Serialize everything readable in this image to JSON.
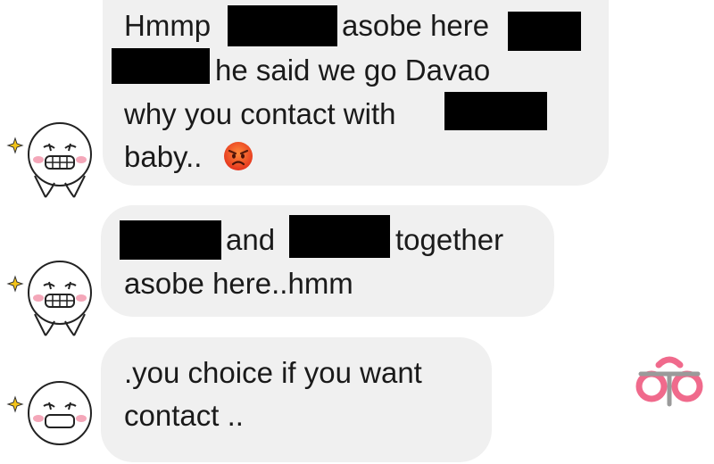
{
  "messages": [
    {
      "lines": [
        {
          "a": "Hmmp",
          "b": "asobe here"
        },
        {
          "a": "he said we go Davao"
        },
        {
          "a": "why you contact with"
        },
        {
          "a": "baby.."
        }
      ],
      "emoji": "angry-face-emoji"
    },
    {
      "lines": [
        {
          "a": "and",
          "b": "together"
        },
        {
          "a": "asobe here..hmm"
        }
      ]
    },
    {
      "lines": [
        {
          "a": ".you choice if you want"
        },
        {
          "a": "contact .."
        }
      ]
    }
  ],
  "sender": {
    "avatar": "smiling-sticker-avatar",
    "sparkle": "sparkle-icon"
  },
  "watermark": {
    "icon": "pink-watermark-logo"
  },
  "colors": {
    "bubble": "#f0f0f0",
    "text": "#1a1a1a",
    "redaction": "#000000",
    "watermark": "#f06a8c",
    "sparkle": "#f5c518"
  }
}
